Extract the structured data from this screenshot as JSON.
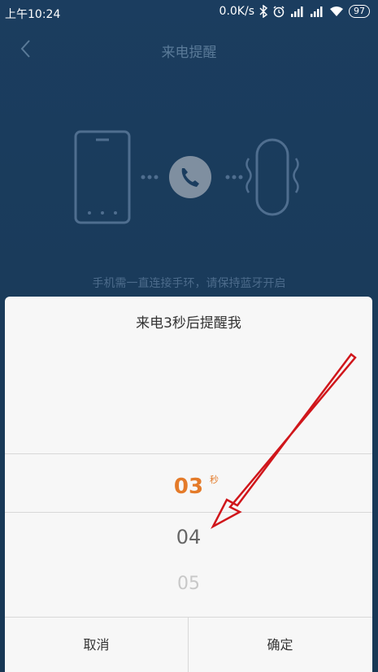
{
  "status_bar": {
    "time": "上午10:24",
    "network_speed": "0.0K/s",
    "battery": "97",
    "icons": [
      "bluetooth-icon",
      "alarm-icon",
      "signal-icon",
      "signal-icon",
      "wifi-icon"
    ]
  },
  "header": {
    "title": "来电提醒",
    "back_icon": "chevron-left-icon"
  },
  "illustration": {
    "icons": [
      "phone-outline-icon",
      "call-icon",
      "band-vibrate-icon"
    ]
  },
  "hint": "手机需一直连接手环，请保持蓝牙开启",
  "dialog": {
    "title": "来电3秒后提醒我",
    "picker": {
      "items": [
        "03",
        "04",
        "05"
      ],
      "selected": "03",
      "unit": "秒"
    },
    "cancel_label": "取消",
    "confirm_label": "确定"
  },
  "colors": {
    "background": "#1b3d5f",
    "accent": "#e47b2a",
    "annotation_arrow": "#d0161b"
  }
}
